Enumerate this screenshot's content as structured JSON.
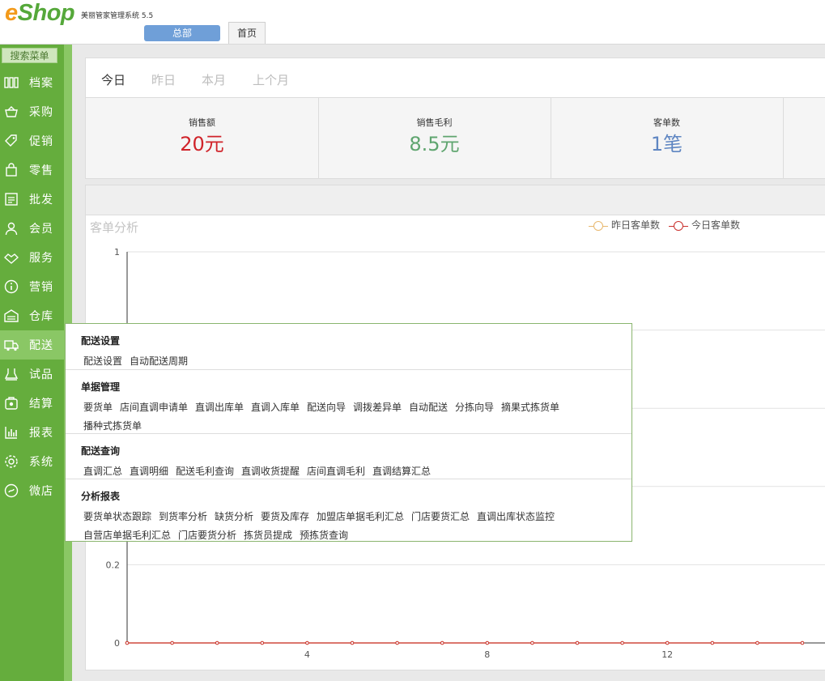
{
  "app": {
    "logo_e": "e",
    "logo_shop": "Shop",
    "title": "美丽管家管理系统 5.5",
    "branch": "总部",
    "tab_home": "首页"
  },
  "sidebar": {
    "search": "搜索菜单",
    "items": [
      {
        "label": "档案",
        "icon": "archive-icon"
      },
      {
        "label": "采购",
        "icon": "basket-icon"
      },
      {
        "label": "促销",
        "icon": "tag-icon"
      },
      {
        "label": "零售",
        "icon": "shopping-bag-icon"
      },
      {
        "label": "批发",
        "icon": "wholesale-icon"
      },
      {
        "label": "会员",
        "icon": "user-icon"
      },
      {
        "label": "服务",
        "icon": "handshake-icon"
      },
      {
        "label": "营销",
        "icon": "info-circle-icon"
      },
      {
        "label": "仓库",
        "icon": "warehouse-icon"
      },
      {
        "label": "配送",
        "icon": "truck-icon",
        "active": true
      },
      {
        "label": "试品",
        "icon": "sample-icon"
      },
      {
        "label": "结算",
        "icon": "settlement-icon"
      },
      {
        "label": "报表",
        "icon": "bar-chart-icon"
      },
      {
        "label": "系统",
        "icon": "gear-icon"
      },
      {
        "label": "微店",
        "icon": "micro-shop-icon"
      }
    ]
  },
  "periods": [
    "今日",
    "昨日",
    "本月",
    "上个月"
  ],
  "kpis": [
    {
      "label": "销售额",
      "value": "20元",
      "color": "#d0232a"
    },
    {
      "label": "销售毛利",
      "value": "8.5元",
      "color": "#5fa56f"
    },
    {
      "label": "客单数",
      "value": "1笔",
      "color": "#5f86c2"
    }
  ],
  "chart_data": {
    "type": "line",
    "title": "客单分析",
    "x": [
      0,
      1,
      2,
      3,
      4,
      5,
      6,
      7,
      8,
      9,
      10,
      11,
      12,
      13,
      14,
      15
    ],
    "x_ticks": [
      "4",
      "8",
      "12"
    ],
    "y_ticks": [
      "1",
      "0.2",
      "0"
    ],
    "ylim": [
      0,
      1
    ],
    "grid": true,
    "legend_position": "top-right",
    "series": [
      {
        "name": "昨日客单数",
        "color": "#e8b86e",
        "values": [
          0,
          0,
          0,
          0,
          0,
          0,
          0,
          0,
          0,
          0,
          0,
          0,
          0,
          0,
          0,
          0
        ]
      },
      {
        "name": "今日客单数",
        "color": "#c9302c",
        "values": [
          0,
          0,
          0,
          0,
          0,
          0,
          0,
          0,
          0,
          0,
          0,
          0,
          0,
          0,
          0,
          0
        ]
      }
    ]
  },
  "dropdown": {
    "sections": [
      {
        "title": "配送设置",
        "rows": [
          [
            "配送设置",
            "自动配送周期"
          ]
        ]
      },
      {
        "title": "单据管理",
        "rows": [
          [
            "要货单",
            "店间直调申请单",
            "直调出库单",
            "直调入库单",
            "配送向导",
            "调拨差异单",
            "自动配送",
            "分拣向导",
            "摘果式拣货单"
          ],
          [
            "播种式拣货单"
          ]
        ]
      },
      {
        "title": "配送查询",
        "rows": [
          [
            "直调汇总",
            "直调明细",
            "配送毛利查询",
            "直调收货提醒",
            "店间直调毛利",
            "直调结算汇总"
          ]
        ]
      },
      {
        "title": "分析报表",
        "rows": [
          [
            "要货单状态跟踪",
            "到货率分析",
            "缺货分析",
            "要货及库存",
            "加盟店单据毛利汇总",
            "门店要货汇总",
            "直调出库状态监控"
          ],
          [
            "自营店单据毛利汇总",
            "门店要货分析",
            "拣货员提成",
            "预拣货查询"
          ]
        ]
      }
    ]
  }
}
